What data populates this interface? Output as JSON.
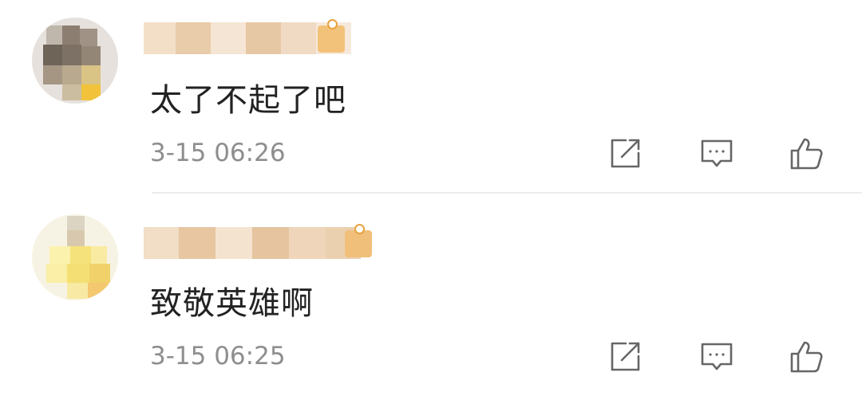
{
  "comments": [
    {
      "text": "太了不起了吧",
      "time": "3-15 06:26",
      "avatar_colors": [
        "#7a6e60",
        "#8b7c6c",
        "#d8c28a",
        "#f2c23a"
      ],
      "name_colors": [
        "#f1d9bd",
        "#e8c9a8",
        "#f4e2cf",
        "#ecd2b6",
        "#f6e7d6"
      ]
    },
    {
      "text": "致敬英雄啊",
      "time": "3-15 06:25",
      "avatar_colors": [
        "#f7e97c",
        "#f3e27a",
        "#f5d79a",
        "#efe3c6"
      ],
      "name_colors": [
        "#ecd1b1",
        "#f3dcc3",
        "#e6c7a4",
        "#f7e6d3",
        "#ead3b8"
      ]
    }
  ],
  "actions": {
    "share_icon": "share-icon",
    "comment_icon": "comment-icon",
    "like_icon": "thumbs-up-icon"
  },
  "colors": {
    "text": "#222222",
    "timestamp": "#8e8e8e",
    "icon": "#666666",
    "badge": "#f2c27a"
  }
}
